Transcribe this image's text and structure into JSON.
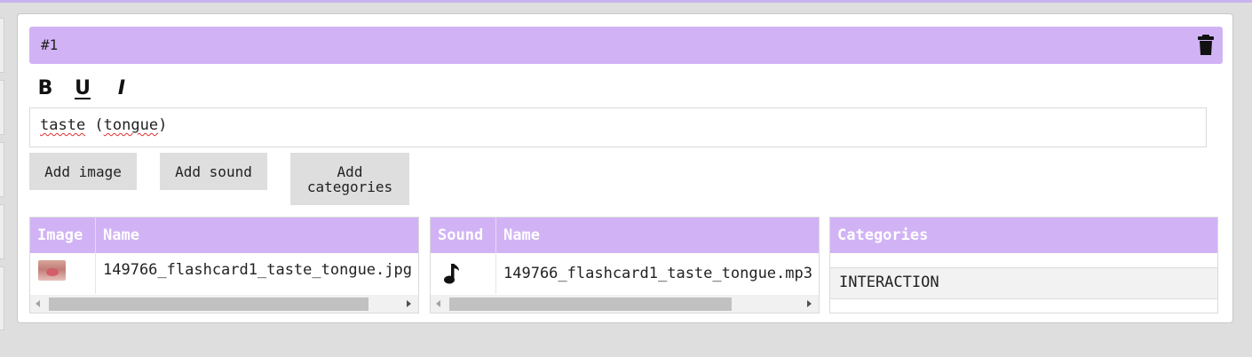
{
  "card": {
    "id_label": "#1",
    "delete_icon": "trash-icon",
    "accent_color": "#d1b3f5"
  },
  "format_toolbar": {
    "bold_label": "B",
    "underline_label": "U",
    "italic_label": "I"
  },
  "text_input": {
    "word1": "taste",
    "open_paren": " (",
    "word2": "tongue",
    "close_paren": ")"
  },
  "buttons": {
    "add_image": "Add image",
    "add_sound": "Add sound",
    "add_categories": "Add categories"
  },
  "image_table": {
    "headers": [
      "Image",
      "Name"
    ],
    "rows": [
      {
        "thumbnail": "tongue-thumbnail",
        "name": "149766_flashcard1_taste_tongue.jpg"
      }
    ]
  },
  "sound_table": {
    "headers": [
      "Sound",
      "Name"
    ],
    "rows": [
      {
        "icon": "music-note-icon",
        "name": "149766_flashcard1_taste_tongue.mp3"
      }
    ]
  },
  "categories_table": {
    "headers": [
      "Categories"
    ],
    "rows": [
      "INTERACTION"
    ]
  }
}
